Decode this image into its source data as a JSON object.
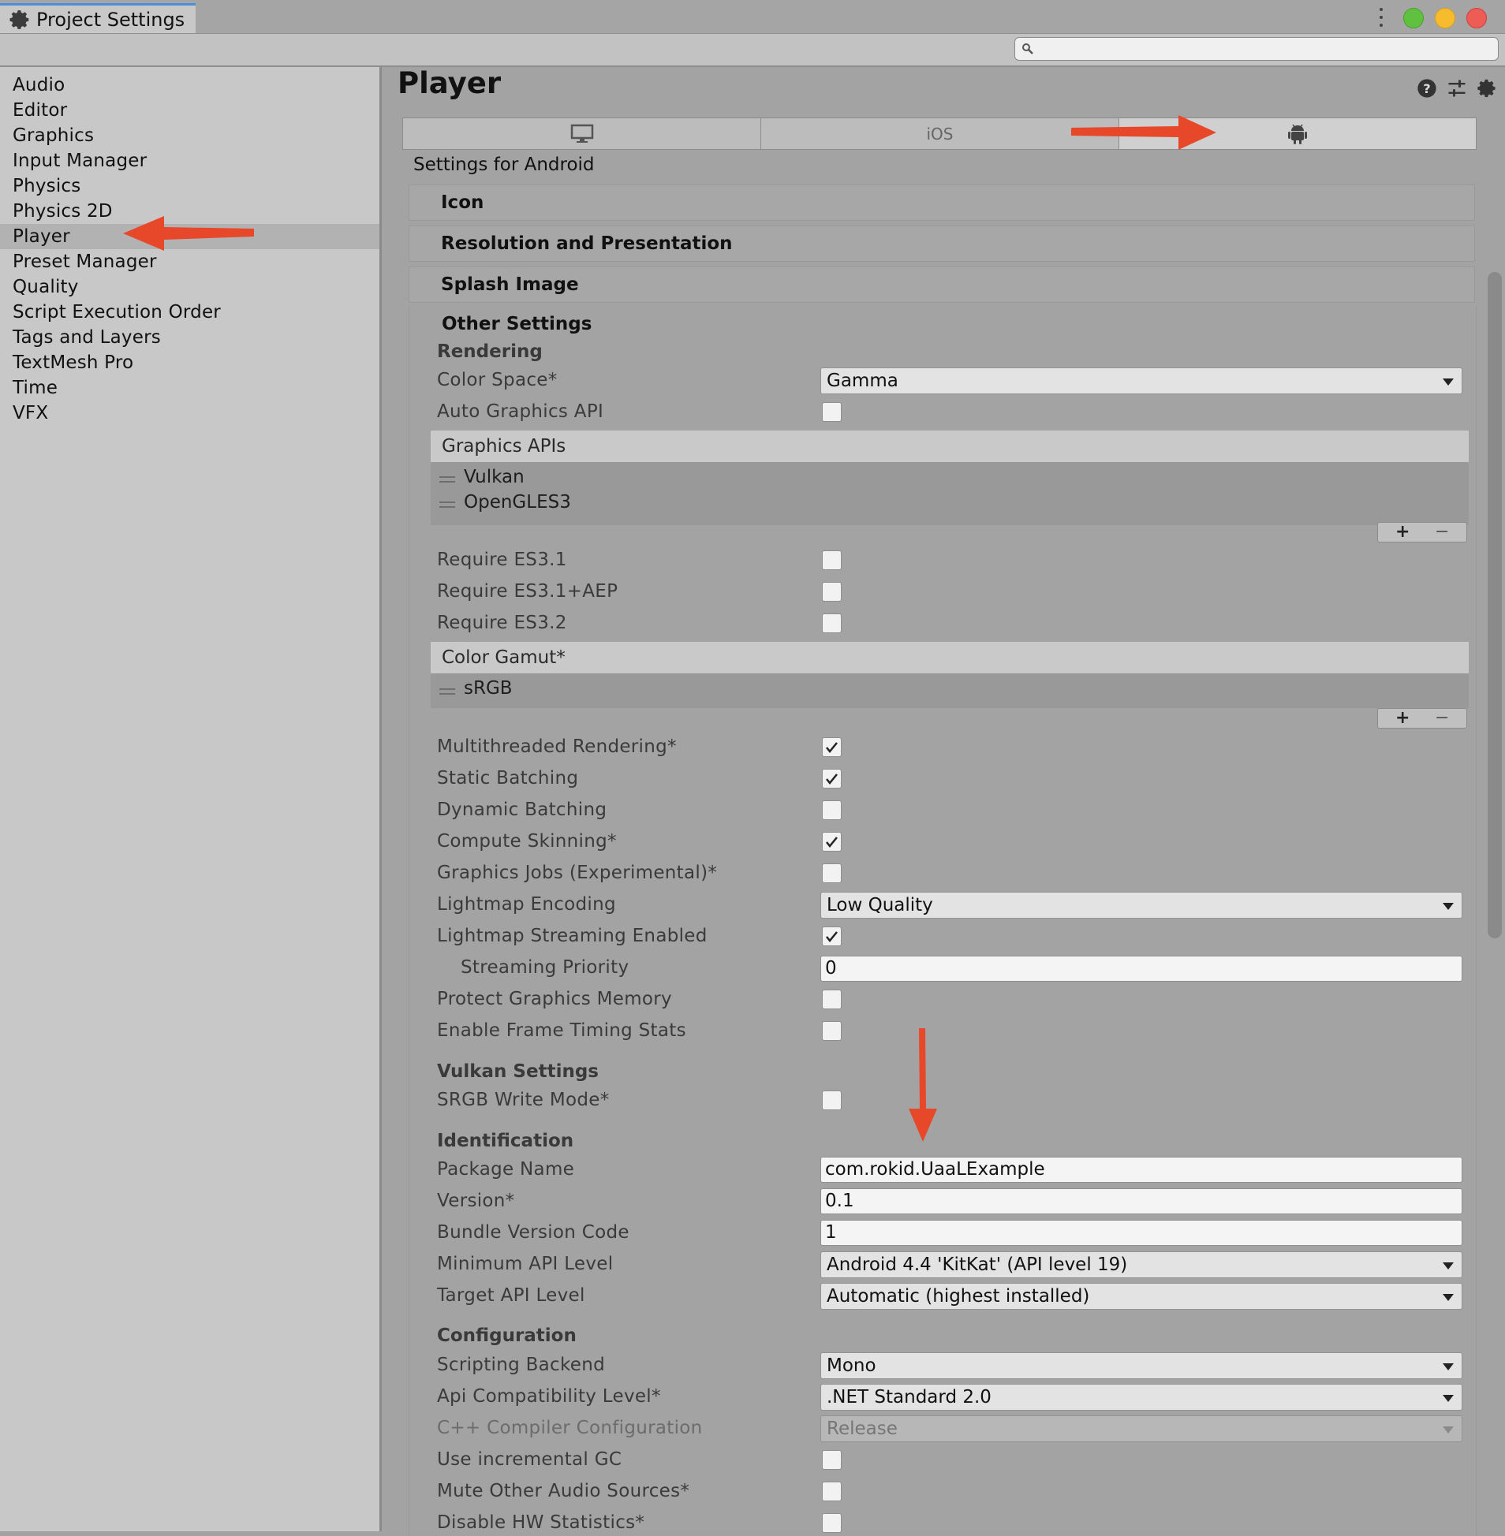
{
  "window": {
    "title": "Project Settings"
  },
  "window_controls": {
    "close_color": "#ee5c56",
    "minimize_color": "#f7bc2d",
    "maximize_color": "#5fc13f"
  },
  "search": {
    "value": "",
    "placeholder": ""
  },
  "sidebar": {
    "items": [
      {
        "label": "Audio"
      },
      {
        "label": "Editor"
      },
      {
        "label": "Graphics"
      },
      {
        "label": "Input Manager"
      },
      {
        "label": "Physics"
      },
      {
        "label": "Physics 2D"
      },
      {
        "label": "Player",
        "selected": true
      },
      {
        "label": "Preset Manager"
      },
      {
        "label": "Quality"
      },
      {
        "label": "Script Execution Order"
      },
      {
        "label": "Tags and Layers"
      },
      {
        "label": "TextMesh Pro"
      },
      {
        "label": "Time"
      },
      {
        "label": "VFX"
      }
    ]
  },
  "header": {
    "title": "Player",
    "icons": [
      "help-icon",
      "preset-icon",
      "gear-icon"
    ]
  },
  "platform_tabs": [
    {
      "icon": "monitor-icon",
      "label": ""
    },
    {
      "icon": "",
      "label": "iOS"
    },
    {
      "icon": "android-icon",
      "label": "",
      "active": true
    }
  ],
  "settings_for": "Settings for Android",
  "foldouts": {
    "icon": "Icon",
    "resolution": "Resolution and Presentation",
    "splash": "Splash Image",
    "other": "Other Settings"
  },
  "rendering": {
    "section": "Rendering",
    "color_space": {
      "label": "Color Space*",
      "value": "Gamma"
    },
    "auto_graphics_api": {
      "label": "Auto Graphics API",
      "checked": false
    },
    "graphics_apis": {
      "header": "Graphics APIs",
      "items": [
        "Vulkan",
        "OpenGLES3"
      ]
    },
    "require_es31": {
      "label": "Require ES3.1",
      "checked": false
    },
    "require_es31_aep": {
      "label": "Require ES3.1+AEP",
      "checked": false
    },
    "require_es32": {
      "label": "Require ES3.2",
      "checked": false
    },
    "color_gamut": {
      "header": "Color Gamut*",
      "items": [
        "sRGB"
      ]
    },
    "multithreaded": {
      "label": "Multithreaded Rendering*",
      "checked": true
    },
    "static_batching": {
      "label": "Static Batching",
      "checked": true
    },
    "dynamic_batching": {
      "label": "Dynamic Batching",
      "checked": false
    },
    "compute_skinning": {
      "label": "Compute Skinning*",
      "checked": true
    },
    "graphics_jobs": {
      "label": "Graphics Jobs (Experimental)*",
      "checked": false
    },
    "lightmap_encoding": {
      "label": "Lightmap Encoding",
      "value": "Low Quality"
    },
    "lightmap_streaming": {
      "label": "Lightmap Streaming Enabled",
      "checked": true
    },
    "streaming_priority": {
      "label": "Streaming Priority",
      "value": "0"
    },
    "protect_memory": {
      "label": "Protect Graphics Memory",
      "checked": false
    },
    "frame_timing": {
      "label": "Enable Frame Timing Stats",
      "checked": false
    }
  },
  "vulkan": {
    "section": "Vulkan Settings",
    "srgb_write": {
      "label": "SRGB Write Mode*",
      "checked": false
    }
  },
  "identification": {
    "section": "Identification",
    "package_name": {
      "label": "Package Name",
      "value": "com.rokid.UaaLExample"
    },
    "version": {
      "label": "Version*",
      "value": "0.1"
    },
    "bundle_code": {
      "label": "Bundle Version Code",
      "value": "1"
    },
    "min_api": {
      "label": "Minimum API Level",
      "value": "Android 4.4 'KitKat' (API level 19)"
    },
    "target_api": {
      "label": "Target API Level",
      "value": "Automatic (highest installed)"
    }
  },
  "configuration": {
    "section": "Configuration",
    "scripting_backend": {
      "label": "Scripting Backend",
      "value": "Mono"
    },
    "api_compat": {
      "label": "Api Compatibility Level*",
      "value": ".NET Standard 2.0"
    },
    "cpp_compiler": {
      "label": "C++ Compiler Configuration",
      "value": "Release"
    },
    "incremental_gc": {
      "label": "Use incremental GC",
      "checked": false
    },
    "mute_audio": {
      "label": "Mute Other Audio Sources*",
      "checked": false
    },
    "disable_hw_stats": {
      "label": "Disable HW Statistics*",
      "checked": false
    }
  },
  "annotation_color": "#e8482a"
}
